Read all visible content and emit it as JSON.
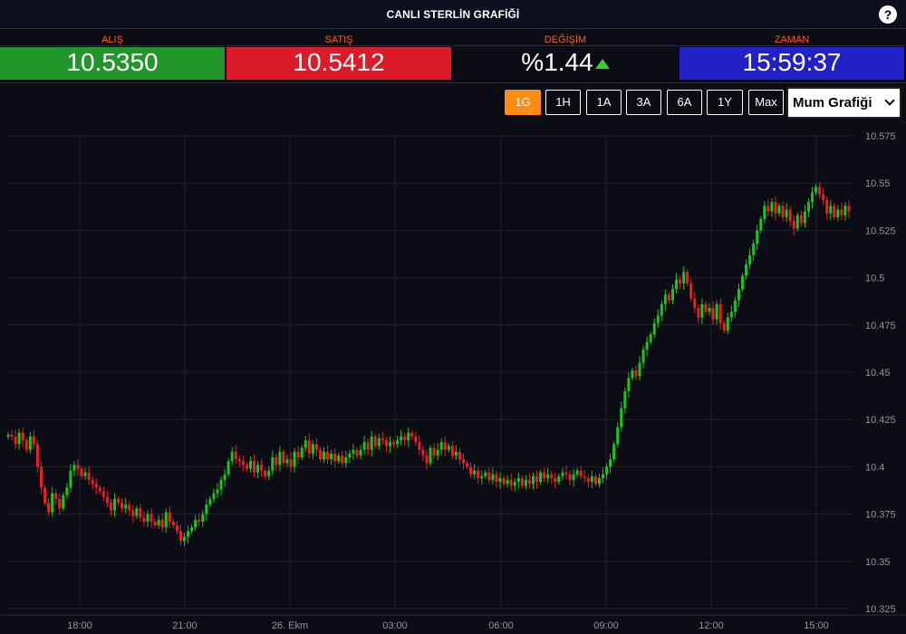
{
  "header": {
    "title": "CANLI STERLİN GRAFİĞİ",
    "help": "?"
  },
  "quotes": {
    "buy": {
      "label": "ALIŞ",
      "value": "10.5350"
    },
    "sell": {
      "label": "SATIŞ",
      "value": "10.5412"
    },
    "change": {
      "label": "DEĞİŞİM",
      "value": "%1.44"
    },
    "time": {
      "label": "ZAMAN",
      "value": "15:59:37"
    }
  },
  "ranges": [
    "1G",
    "1H",
    "1A",
    "3A",
    "6A",
    "1Y",
    "Max"
  ],
  "active_range": "1G",
  "chart_type_select": "Mum Grafiği",
  "colors": {
    "up": "#1ec41e",
    "down": "#e8202a",
    "accent": "#ff8c14",
    "background": "#0b0c14",
    "grid": "#1e2233"
  },
  "chart_data": {
    "type": "candlestick",
    "ylim": [
      10.325,
      10.575
    ],
    "y_ticks": [
      "10.575",
      "10.55",
      "10.525",
      "10.5",
      "10.475",
      "10.45",
      "10.425",
      "10.4",
      "10.375",
      "10.35",
      "10.325"
    ],
    "x_ticks": [
      "18:00",
      "21:00",
      "26. Ekm",
      "03:00",
      "06:00",
      "09:00",
      "12:00",
      "15:00"
    ],
    "close_series": [
      10.417,
      10.416,
      10.412,
      10.418,
      10.414,
      10.409,
      10.416,
      10.412,
      10.4,
      10.389,
      10.381,
      10.376,
      10.386,
      10.383,
      10.378,
      10.385,
      10.389,
      10.398,
      10.401,
      10.399,
      10.395,
      10.397,
      10.393,
      10.391,
      10.389,
      10.387,
      10.384,
      10.381,
      10.377,
      10.383,
      10.381,
      10.378,
      10.38,
      10.377,
      10.374,
      10.378,
      10.373,
      10.371,
      10.375,
      10.371,
      10.369,
      10.372,
      10.368,
      10.376,
      10.371,
      10.369,
      10.366,
      10.361,
      10.363,
      10.366,
      10.368,
      10.372,
      10.371,
      10.375,
      10.38,
      10.383,
      10.386,
      10.388,
      10.393,
      10.396,
      10.403,
      10.408,
      10.404,
      10.403,
      10.401,
      10.399,
      10.403,
      10.397,
      10.401,
      10.398,
      10.395,
      10.398,
      10.405,
      10.401,
      10.408,
      10.402,
      10.404,
      10.4,
      10.408,
      10.405,
      10.41,
      10.414,
      10.407,
      10.412,
      10.409,
      10.404,
      10.408,
      10.404,
      10.407,
      10.403,
      10.406,
      10.402,
      10.405,
      10.407,
      10.409,
      10.406,
      10.409,
      10.413,
      10.409,
      10.416,
      10.411,
      10.415,
      10.414,
      10.411,
      10.413,
      10.412,
      10.414,
      10.416,
      10.414,
      10.418,
      10.416,
      10.413,
      10.409,
      10.406,
      10.402,
      10.41,
      10.406,
      10.409,
      10.413,
      10.409,
      10.411,
      10.406,
      10.408,
      10.404,
      10.402,
      10.4,
      10.396,
      10.398,
      10.394,
      10.395,
      10.397,
      10.393,
      10.396,
      10.392,
      10.394,
      10.391,
      10.393,
      10.39,
      10.392,
      10.394,
      10.39,
      10.393,
      10.391,
      10.395,
      10.392,
      10.397,
      10.394,
      10.396,
      10.394,
      10.392,
      10.395,
      10.397,
      10.396,
      10.393,
      10.396,
      10.398,
      10.395,
      10.394,
      10.392,
      10.395,
      10.391,
      10.394,
      10.396,
      10.4,
      10.404,
      10.412,
      10.421,
      10.431,
      10.44,
      10.447,
      10.451,
      10.448,
      10.455,
      10.462,
      10.466,
      10.47,
      10.476,
      10.48,
      10.486,
      10.491,
      10.488,
      10.494,
      10.499,
      10.497,
      10.503,
      10.497,
      10.489,
      10.484,
      10.479,
      10.486,
      10.482,
      10.484,
      10.478,
      10.486,
      10.476,
      10.472,
      10.479,
      10.482,
      10.488,
      10.494,
      10.501,
      10.507,
      10.512,
      10.518,
      10.525,
      10.531,
      10.538,
      10.535,
      10.54,
      10.534,
      10.538,
      10.532,
      10.536,
      10.53,
      10.526,
      10.533,
      10.529,
      10.535,
      10.54,
      10.545,
      10.548,
      10.544,
      10.541,
      10.534,
      10.538,
      10.532,
      10.536,
      10.533,
      10.538,
      10.535
    ]
  }
}
